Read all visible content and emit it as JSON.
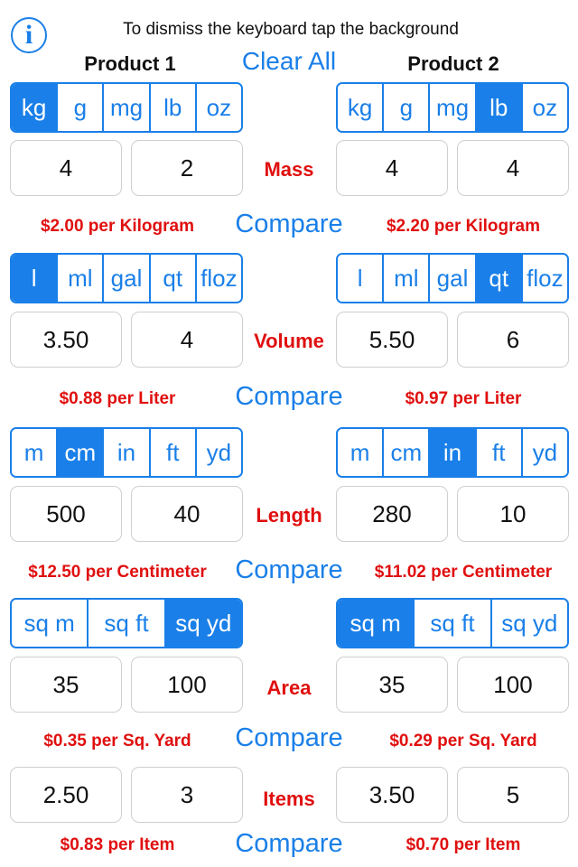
{
  "header": {
    "info_icon": "info-icon",
    "info_glyph": "i",
    "hint": "To dismiss the keyboard tap the background",
    "product1_title": "Product 1",
    "product2_title": "Product 2",
    "clear_all": "Clear All"
  },
  "rows": {
    "mass": {
      "label": "Mass",
      "units": [
        "kg",
        "g",
        "mg",
        "lb",
        "oz"
      ],
      "p1": {
        "selected_unit": "kg",
        "price": "4",
        "quantity": "2",
        "result": "$2.00 per Kilogram"
      },
      "p2": {
        "selected_unit": "lb",
        "price": "4",
        "quantity": "4",
        "result": "$2.20 per Kilogram"
      },
      "compare": "Compare"
    },
    "volume": {
      "label": "Volume",
      "units": [
        "l",
        "ml",
        "gal",
        "qt",
        "floz"
      ],
      "p1": {
        "selected_unit": "l",
        "price": "3.50",
        "quantity": "4",
        "result": "$0.88 per Liter"
      },
      "p2": {
        "selected_unit": "qt",
        "price": "5.50",
        "quantity": "6",
        "result": "$0.97 per Liter"
      },
      "compare": "Compare"
    },
    "length": {
      "label": "Length",
      "units": [
        "m",
        "cm",
        "in",
        "ft",
        "yd"
      ],
      "p1": {
        "selected_unit": "cm",
        "price": "500",
        "quantity": "40",
        "result": "$12.50 per Centimeter"
      },
      "p2": {
        "selected_unit": "in",
        "price": "280",
        "quantity": "10",
        "result": "$11.02 per Centimeter"
      },
      "compare": "Compare"
    },
    "area": {
      "label": "Area",
      "units": [
        "sq m",
        "sq ft",
        "sq yd"
      ],
      "p1": {
        "selected_unit": "sq yd",
        "price": "35",
        "quantity": "100",
        "result": "$0.35 per Sq. Yard"
      },
      "p2": {
        "selected_unit": "sq m",
        "price": "35",
        "quantity": "100",
        "result": "$0.29 per Sq. Yard"
      },
      "compare": "Compare"
    },
    "items": {
      "label": "Items",
      "p1": {
        "price": "2.50",
        "quantity": "3",
        "result": "$0.83 per Item"
      },
      "p2": {
        "price": "3.50",
        "quantity": "5",
        "result": "$0.70 per Item"
      },
      "compare": "Compare"
    }
  },
  "colors": {
    "accent": "#1a7fe8",
    "result_red": "#e00f0f"
  }
}
